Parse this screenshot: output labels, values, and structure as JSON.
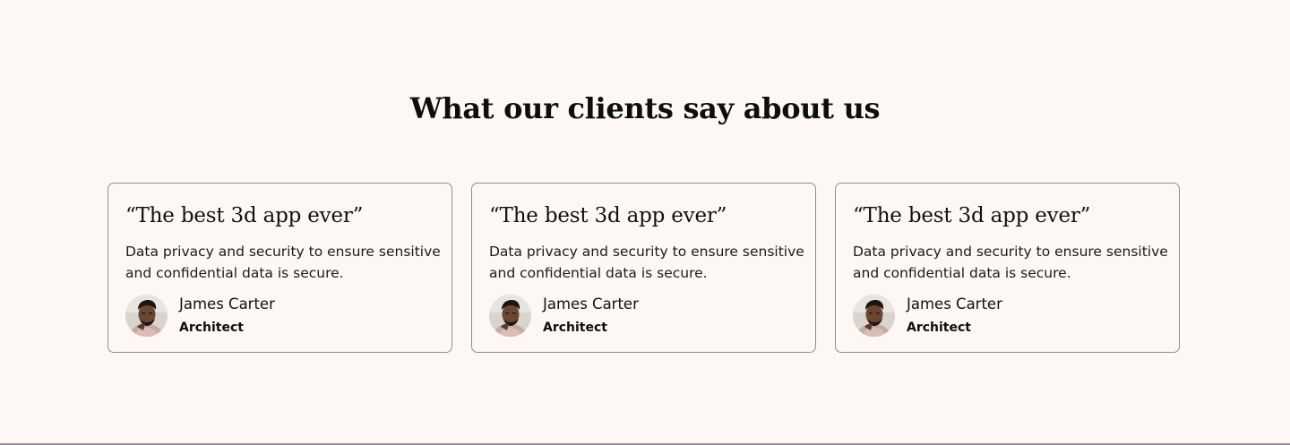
{
  "section": {
    "title": "What our clients say about us"
  },
  "testimonials": [
    {
      "quote": "“The best 3d app ever”",
      "text": "Data privacy and security to ensure sensitive and confidential data is secure.",
      "author_name": "James Carter",
      "author_role": "Architect"
    },
    {
      "quote": "“The best 3d app ever”",
      "text": "Data privacy and security to ensure sensitive and confidential data is secure.",
      "author_name": "James Carter",
      "author_role": "Architect"
    },
    {
      "quote": "“The best 3d app ever”",
      "text": "Data privacy and security to ensure sensitive and confidential data is secure.",
      "author_name": "James Carter",
      "author_role": "Architect"
    }
  ],
  "colors": {
    "background": "#fdf8f3",
    "card_border": "#8b8f95",
    "text": "#111111"
  }
}
